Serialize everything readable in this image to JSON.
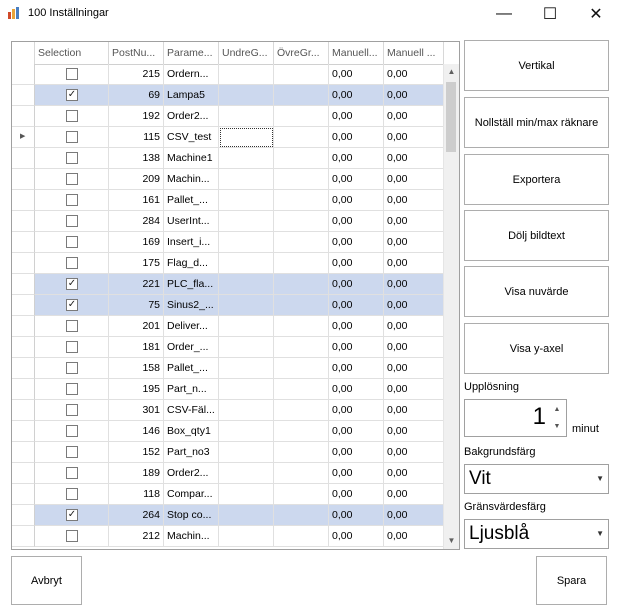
{
  "window": {
    "title": "100 Inställningar",
    "minimize_glyph": "—",
    "maximize_glyph": "☐",
    "close_glyph": "✕"
  },
  "grid": {
    "columns": [
      "Selection",
      "PostNu...",
      "Parame...",
      "UndreG...",
      "ÖvreGr...",
      "Manuell...",
      "Manuell ..."
    ],
    "current_row_index": 3,
    "rows": [
      {
        "checked": false,
        "post": "215",
        "param": "Ordern...",
        "undre": "",
        "ovre": "",
        "man1": "0,00",
        "man2": "0,00"
      },
      {
        "checked": true,
        "post": "69",
        "param": "Lampa5",
        "undre": "",
        "ovre": "",
        "man1": "0,00",
        "man2": "0,00"
      },
      {
        "checked": false,
        "post": "192",
        "param": "Order2...",
        "undre": "",
        "ovre": "",
        "man1": "0,00",
        "man2": "0,00"
      },
      {
        "checked": false,
        "post": "115",
        "param": "CSV_test",
        "undre": "",
        "ovre": "",
        "man1": "0,00",
        "man2": "0,00"
      },
      {
        "checked": false,
        "post": "138",
        "param": "Machine1",
        "undre": "",
        "ovre": "",
        "man1": "0,00",
        "man2": "0,00"
      },
      {
        "checked": false,
        "post": "209",
        "param": "Machin...",
        "undre": "",
        "ovre": "",
        "man1": "0,00",
        "man2": "0,00"
      },
      {
        "checked": false,
        "post": "161",
        "param": "Pallet_...",
        "undre": "",
        "ovre": "",
        "man1": "0,00",
        "man2": "0,00"
      },
      {
        "checked": false,
        "post": "284",
        "param": "UserInt...",
        "undre": "",
        "ovre": "",
        "man1": "0,00",
        "man2": "0,00"
      },
      {
        "checked": false,
        "post": "169",
        "param": "Insert_i...",
        "undre": "",
        "ovre": "",
        "man1": "0,00",
        "man2": "0,00"
      },
      {
        "checked": false,
        "post": "175",
        "param": "Flag_d...",
        "undre": "",
        "ovre": "",
        "man1": "0,00",
        "man2": "0,00"
      },
      {
        "checked": true,
        "post": "221",
        "param": "PLC_fla...",
        "undre": "",
        "ovre": "",
        "man1": "0,00",
        "man2": "0,00"
      },
      {
        "checked": true,
        "post": "75",
        "param": "Sinus2_...",
        "undre": "",
        "ovre": "",
        "man1": "0,00",
        "man2": "0,00"
      },
      {
        "checked": false,
        "post": "201",
        "param": "Deliver...",
        "undre": "",
        "ovre": "",
        "man1": "0,00",
        "man2": "0,00"
      },
      {
        "checked": false,
        "post": "181",
        "param": "Order_...",
        "undre": "",
        "ovre": "",
        "man1": "0,00",
        "man2": "0,00"
      },
      {
        "checked": false,
        "post": "158",
        "param": "Pallet_...",
        "undre": "",
        "ovre": "",
        "man1": "0,00",
        "man2": "0,00"
      },
      {
        "checked": false,
        "post": "195",
        "param": "Part_n...",
        "undre": "",
        "ovre": "",
        "man1": "0,00",
        "man2": "0,00"
      },
      {
        "checked": false,
        "post": "301",
        "param": "CSV-Fäl...",
        "undre": "",
        "ovre": "",
        "man1": "0,00",
        "man2": "0,00"
      },
      {
        "checked": false,
        "post": "146",
        "param": "Box_qty1",
        "undre": "",
        "ovre": "",
        "man1": "0,00",
        "man2": "0,00"
      },
      {
        "checked": false,
        "post": "152",
        "param": "Part_no3",
        "undre": "",
        "ovre": "",
        "man1": "0,00",
        "man2": "0,00"
      },
      {
        "checked": false,
        "post": "189",
        "param": "Order2...",
        "undre": "",
        "ovre": "",
        "man1": "0,00",
        "man2": "0,00"
      },
      {
        "checked": false,
        "post": "118",
        "param": "Compar...",
        "undre": "",
        "ovre": "",
        "man1": "0,00",
        "man2": "0,00"
      },
      {
        "checked": true,
        "post": "264",
        "param": "Stop co...",
        "undre": "",
        "ovre": "",
        "man1": "0,00",
        "man2": "0,00"
      },
      {
        "checked": false,
        "post": "212",
        "param": "Machin...",
        "undre": "",
        "ovre": "",
        "man1": "0,00",
        "man2": "0,00"
      }
    ]
  },
  "buttons": {
    "vertikal": "Vertikal",
    "nollstall": "Nollställ min/max räknare",
    "exportera": "Exportera",
    "dolj": "Dölj bildtext",
    "visa_nuvarde": "Visa nuvärde",
    "visa_yaxel": "Visa y-axel",
    "avbryt": "Avbryt",
    "spara": "Spara"
  },
  "resolution": {
    "label": "Upplösning",
    "value": "1",
    "unit": "minut"
  },
  "background_color": {
    "label": "Bakgrundsfärg",
    "value": "Vit"
  },
  "limit_color": {
    "label": "Gränsvärdesfärg",
    "value": "Ljusblå"
  },
  "colors": {
    "selected_row": "#ccd8ee",
    "border": "#adadad"
  }
}
